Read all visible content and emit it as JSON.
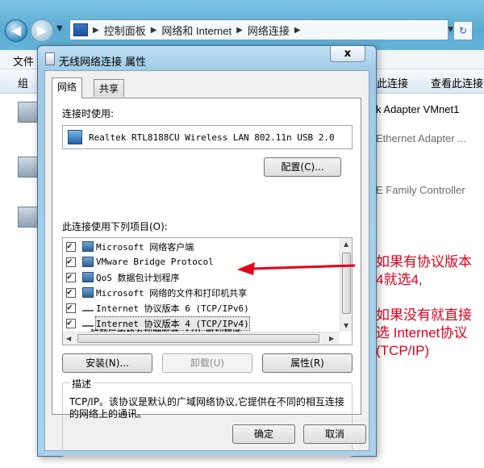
{
  "explorer": {
    "address": {
      "segments": [
        "控制面板",
        "网络和 Internet",
        "网络连接"
      ]
    },
    "menubar": {
      "file_label": "文件"
    },
    "toolbar": {
      "organize_label": "组",
      "connect_label": "此连接",
      "view_status_label": "查看此连接"
    },
    "adapters": [
      {
        "label": "k Adapter VMnet1",
        "grey": false
      },
      {
        "label": "Ethernet Adapter ...",
        "grey": true
      },
      {
        "label": "E Family Controller",
        "grey": true
      }
    ]
  },
  "annotation": {
    "line1": "如果有协议版本",
    "line2": "4就选4,",
    "line3": "如果没有就直接",
    "line4": "选 Internet协议",
    "line5": "(TCP/IP)",
    "color": "#e0001b"
  },
  "dialog": {
    "title": "无线网络连接 属性",
    "close_label": "x",
    "tabs": [
      "网络",
      "共享"
    ],
    "connect_using_label": "连接时使用:",
    "device_name": "Realtek RTL8188CU Wireless LAN 802.11n USB 2.0",
    "configure_label": "配置(C)...",
    "items_label": "此连接使用下列项目(O):",
    "items": [
      {
        "label": "Microsoft 网络客户端",
        "icon": "network-client-icon"
      },
      {
        "label": "VMware Bridge Protocol",
        "icon": "bridge-protocol-icon"
      },
      {
        "label": "QoS 数据包计划程序",
        "icon": "qos-scheduler-icon"
      },
      {
        "label": "Microsoft 网络的文件和打印机共享",
        "icon": "file-printer-sharing-icon"
      },
      {
        "label": "Internet 协议版本 6 (TCP/IPv6)",
        "icon": "protocol-icon"
      },
      {
        "label": "Internet 协议版本 4 (TCP/IPv4)",
        "icon": "protocol-icon",
        "selected": true
      },
      {
        "label": "链路层拓扑发现映射器 I/O 驱动程序",
        "icon": "protocol-icon"
      }
    ],
    "install_label": "安装(N)...",
    "uninstall_label": "卸载(U)",
    "properties_label": "属性(R)",
    "description_title": "描述",
    "description_text": "TCP/IP。该协议是默认的广域网络协议,它提供在不同的相互连接的网络上的通讯。",
    "ok_label": "确定",
    "cancel_label": "取消"
  }
}
